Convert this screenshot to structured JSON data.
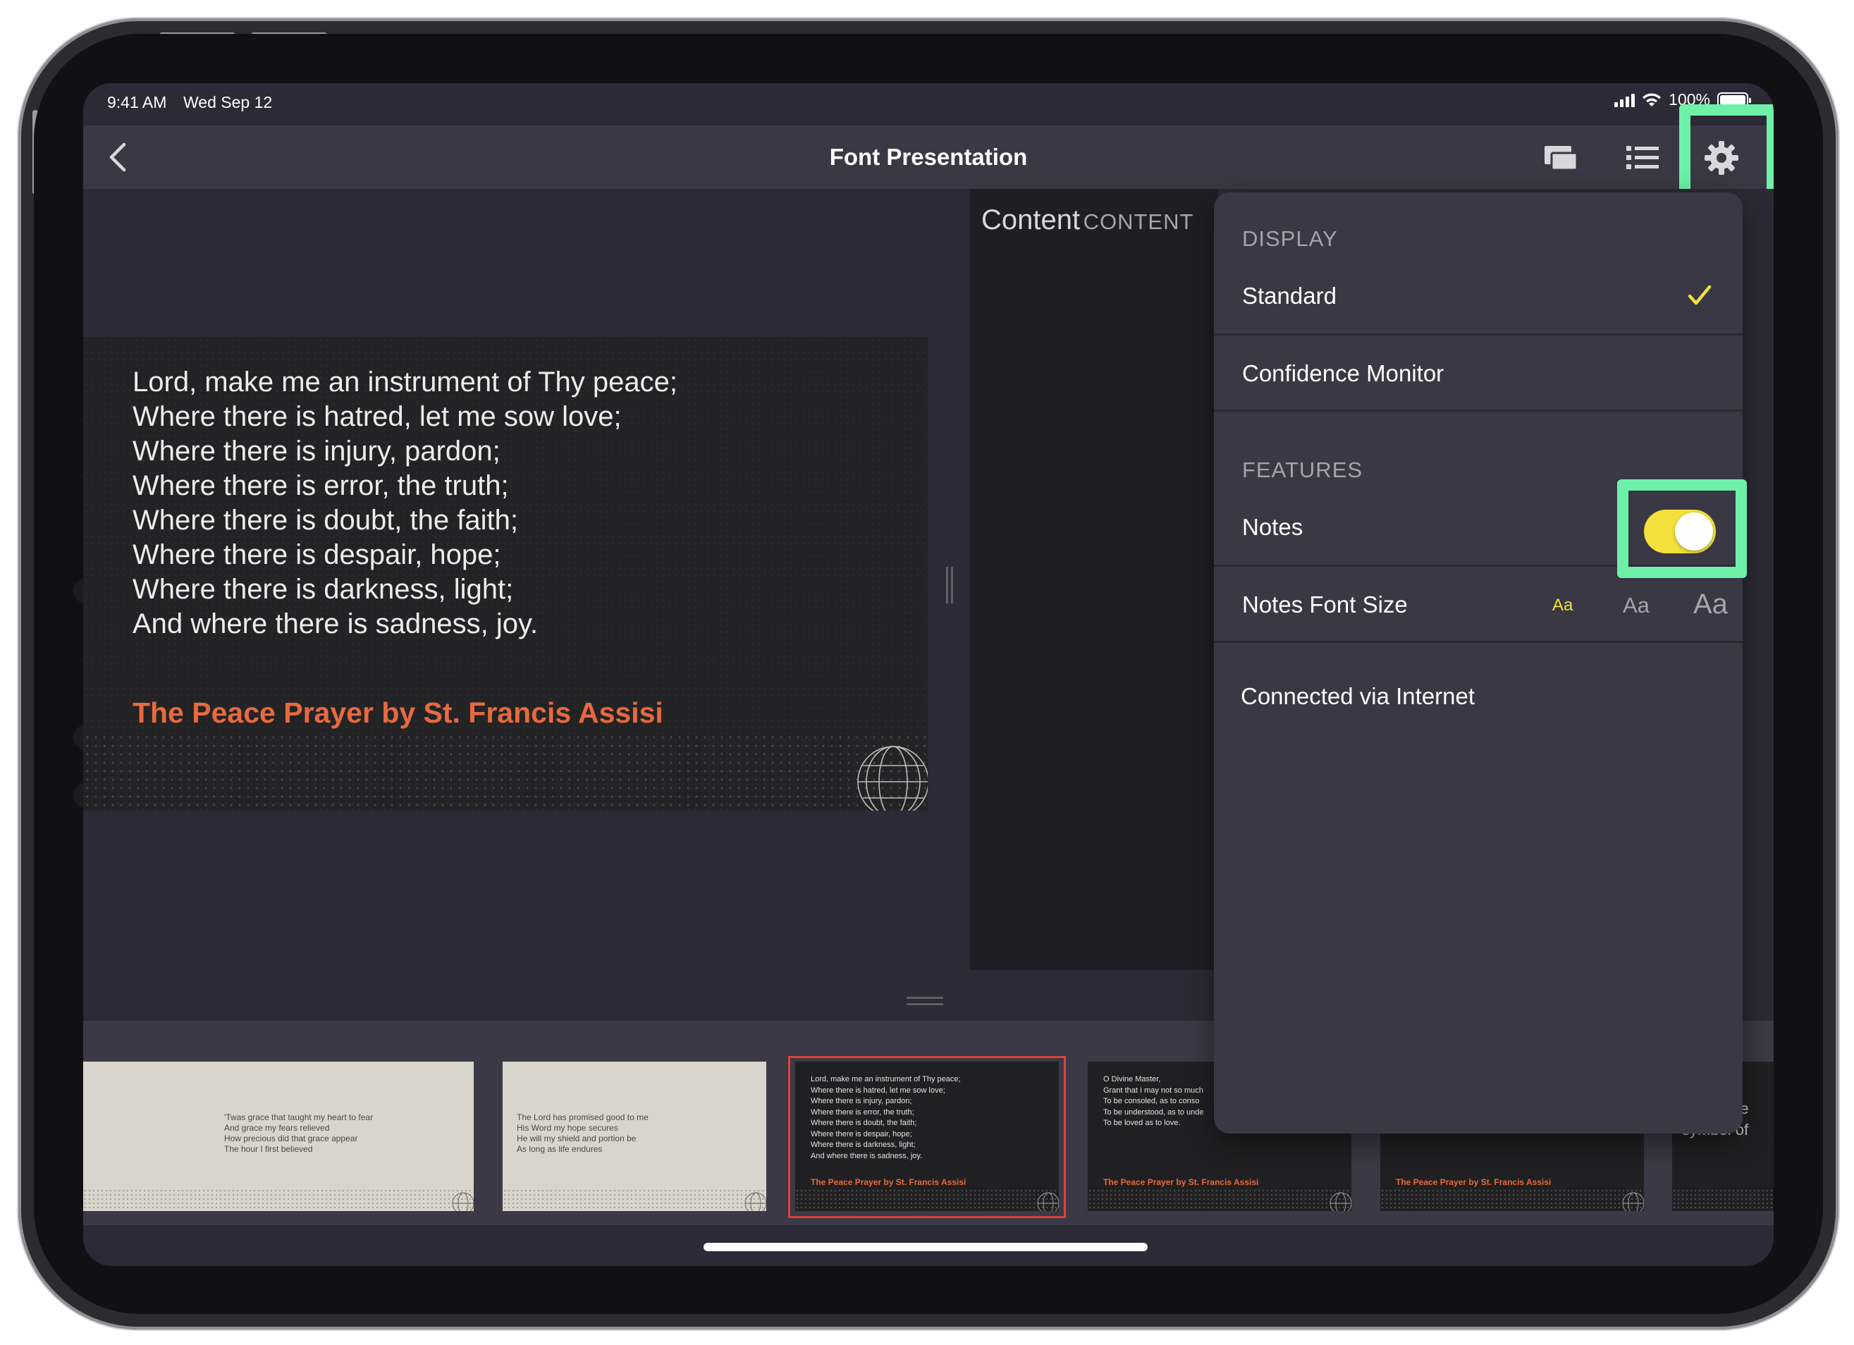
{
  "status_bar": {
    "time": "9:41 AM",
    "date": "Wed Sep 12",
    "battery": "100%"
  },
  "nav": {
    "title": "Font Presentation",
    "back_icon": "chevron-left-icon",
    "icons": [
      "display-icon",
      "list-icon",
      "gear-icon"
    ]
  },
  "slide": {
    "lines": [
      "Lord, make me an instrument of Thy peace;",
      "Where there is hatred, let me sow love;",
      "Where there is injury, pardon;",
      "Where there is error, the truth;",
      "Where there is doubt, the faith;",
      "Where there is despair, hope;",
      "Where there is darkness, light;",
      "And where there is sadness, joy."
    ],
    "title": "The Peace Prayer by St. Francis Assisi"
  },
  "notes": {
    "title": "Content",
    "subtitle": "CONTENT"
  },
  "settings": {
    "display_header": "DISPLAY",
    "standard": "Standard",
    "confidence_monitor": "Confidence Monitor",
    "features_header": "FEATURES",
    "notes": "Notes",
    "notes_enabled": true,
    "notes_font_size": "Notes Font Size",
    "font_size_options": [
      "Aa",
      "Aa",
      "Aa"
    ],
    "font_size_selected_index": 0,
    "connection_status": "Connected via Internet"
  },
  "thumbnails": [
    {
      "style": "light",
      "lines": []
    },
    {
      "style": "light",
      "lines": [
        "'Twas grace that taught my heart to fear",
        "And grace my fears relieved",
        "How precious did that grace appear",
        "The hour I first believed"
      ]
    },
    {
      "style": "light",
      "lines": [
        "The Lord has promised good to me",
        "His Word my hope secures",
        "He will my shield and portion be",
        "As long as life endures"
      ]
    },
    {
      "style": "dark",
      "selected": true,
      "lines": [
        "Lord, make me an instrument of Thy peace;",
        "Where there is hatred, let me sow love;",
        "Where there is injury, pardon;",
        "Where there is error, the truth;",
        "Where there is doubt, the faith;",
        "Where there is despair, hope;",
        "Where there is darkness, light;",
        "And where there is sadness, joy."
      ],
      "title": "The Peace Prayer by St. Francis Assisi"
    },
    {
      "style": "dark",
      "lines": [
        "O Divine Master,",
        "Grant that I may not so much",
        "To be consoled, as to conso",
        "To be understood, as to unde",
        "To be loved as to love."
      ],
      "title": "The Peace Prayer by St. Francis Assisi"
    },
    {
      "style": "dark",
      "lines": [],
      "title": "The Peace Prayer by St. Francis Assisi"
    }
  ],
  "partial_thumbnail_text": [
    "ate",
    "symbol of"
  ],
  "colors": {
    "accent_yellow": "#f3e03a",
    "highlight_green": "#6ef0a8",
    "slide_title_orange": "#e8693f",
    "selection_red": "#d9433b"
  }
}
